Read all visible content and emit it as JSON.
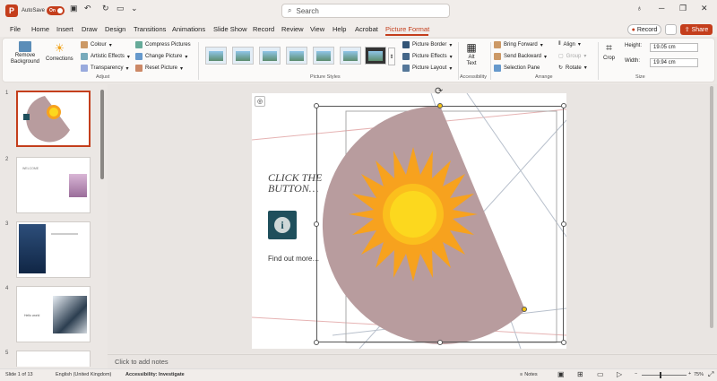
{
  "titlebar": {
    "autosave_label": "AutoSave",
    "autosave_state": "On",
    "search_placeholder": "Search",
    "search_icon": "search-icon"
  },
  "menu": {
    "items": [
      "File",
      "Home",
      "Insert",
      "Draw",
      "Design",
      "Transitions",
      "Animations",
      "Slide Show",
      "Record",
      "Review",
      "View",
      "Help",
      "Acrobat",
      "Picture Format"
    ],
    "active": "Picture Format",
    "record_label": "Record",
    "share_label": "Share"
  },
  "ribbon": {
    "remove_bg": "Remove Background",
    "corrections": "Corrections",
    "colour": "Colour",
    "artistic": "Artistic Effects",
    "transparency": "Transparency",
    "compress": "Compress Pictures",
    "change": "Change Picture",
    "reset": "Reset Picture",
    "adjust_group": "Adjust",
    "styles_group": "Picture Styles",
    "border": "Picture Border",
    "effects": "Picture Effects",
    "layout": "Picture Layout",
    "alt_text": "Alt Text",
    "accessibility_group": "Accessibility",
    "bring_forward": "Bring Forward",
    "send_backward": "Send Backward",
    "selection_pane": "Selection Pane",
    "align": "Align",
    "group": "Group",
    "rotate": "Rotate",
    "arrange_group": "Arrange",
    "crop": "Crop",
    "height_label": "Height:",
    "height_value": "19.05 cm",
    "width_label": "Width:",
    "width_value": "19.94 cm",
    "size_group": "Size"
  },
  "thumbnails": {
    "numbers": [
      "1",
      "2",
      "3",
      "4",
      "5"
    ],
    "slide2_text": "WELCOME",
    "slide4_text": "Hello world"
  },
  "slide": {
    "heading": "CLICK THE BUTTON…",
    "link_text": "Find out more…",
    "info_icon": "info-icon"
  },
  "notes": {
    "placeholder": "Click to add notes"
  },
  "status": {
    "slide_info": "Slide 1 of 13",
    "language": "English (United Kingdom)",
    "accessibility": "Accessibility: Investigate",
    "notes_label": "Notes",
    "zoom": "75%"
  },
  "colors": {
    "accent": "#c43e1c",
    "shape_fill": "#b89c9e",
    "sun_outer": "#f7a21e",
    "sun_inner": "#fcd81e",
    "info_box": "#1f4f5c"
  }
}
